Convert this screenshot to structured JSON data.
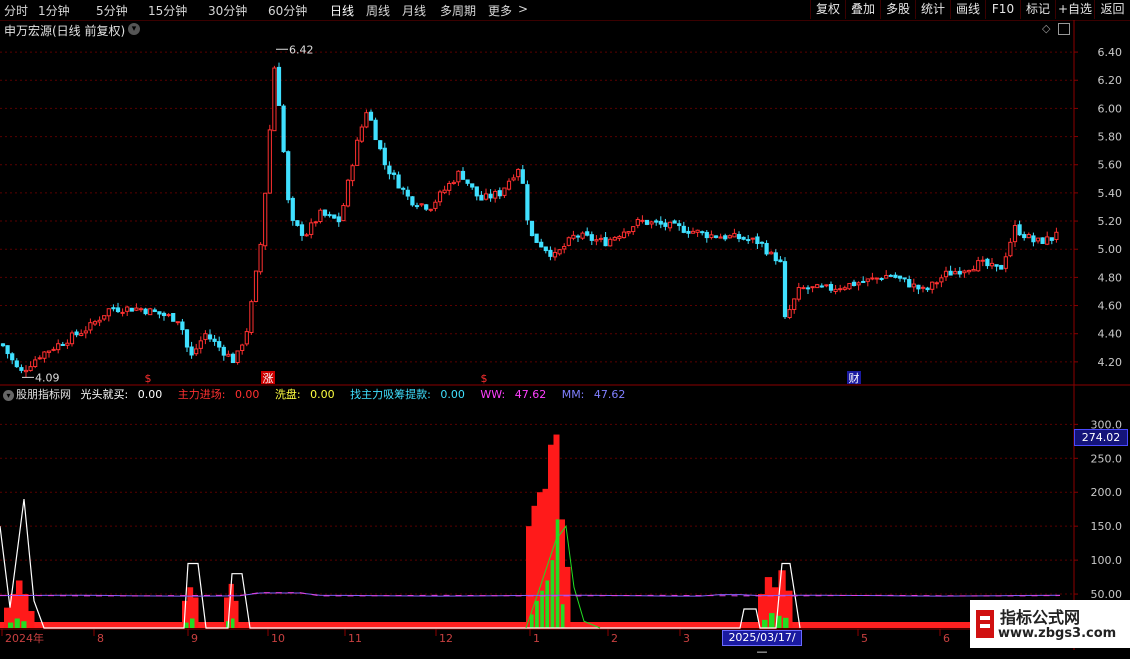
{
  "toolbar": {
    "periods": [
      "分时",
      "1分钟",
      "5分钟",
      "15分钟",
      "30分钟",
      "60分钟",
      "日线",
      "周线",
      "月线",
      "多周期",
      "更多"
    ],
    "active_period": "日线",
    "more_arrow": ">",
    "actions": [
      "复权",
      "叠加",
      "多股",
      "统计",
      "画线",
      "F10",
      "标记",
      "+自选",
      "返回"
    ]
  },
  "main_title": "申万宏源(日线 前复权)",
  "main_axis": {
    "labels": [
      "6.40",
      "6.20",
      "6.00",
      "5.80",
      "5.60",
      "5.40",
      "5.20",
      "5.00",
      "4.80",
      "4.60",
      "4.40",
      "4.20"
    ],
    "values": [
      6.4,
      6.2,
      6.0,
      5.8,
      5.6,
      5.4,
      5.2,
      5.0,
      4.8,
      4.6,
      4.4,
      4.2
    ]
  },
  "annotations": {
    "high": "6.42",
    "low": "4.09",
    "markers": [
      "$",
      "涨",
      "$",
      "财"
    ]
  },
  "indicator": {
    "name": "股朋指标网",
    "items": [
      {
        "label": "光头就买:",
        "value": "0.00",
        "color": "#ffffff"
      },
      {
        "label": "主力进场:",
        "value": "0.00",
        "color": "#ff3030"
      },
      {
        "label": "洗盘:",
        "value": "0.00",
        "color": "#ffff40"
      },
      {
        "label": "找主力吸筹提款:",
        "value": "0.00",
        "color": "#40e0ff"
      },
      {
        "label": "WW:",
        "value": "47.62",
        "color": "#ff40ff"
      },
      {
        "label": "MM:",
        "value": "47.62",
        "color": "#8080ff"
      }
    ],
    "axis_labels": [
      "300.0",
      "250.0",
      "200.0",
      "150.0",
      "100.0",
      "50.00"
    ],
    "axis_values": [
      300,
      250,
      200,
      150,
      100,
      50
    ],
    "current_value": "274.02"
  },
  "date_axis": {
    "labels": [
      "2024年",
      "8",
      "9",
      "10",
      "11",
      "12",
      "1",
      "2",
      "3",
      "5",
      "6"
    ],
    "cursor_date": "2025/03/17/—"
  },
  "watermark": {
    "title": "指标公式网",
    "url": "www.zbgs3.com"
  },
  "colors": {
    "up": "#ff3030",
    "down": "#40e0ff",
    "grid": "#5a0000",
    "axis_line": "#8b0000"
  },
  "chart_data": {
    "type": "candlestick",
    "price_range": [
      4.05,
      6.5
    ],
    "high_value": 6.42,
    "low_value": 4.09,
    "indicator_range": [
      0,
      330
    ],
    "ww_mm_level": 47.62
  }
}
